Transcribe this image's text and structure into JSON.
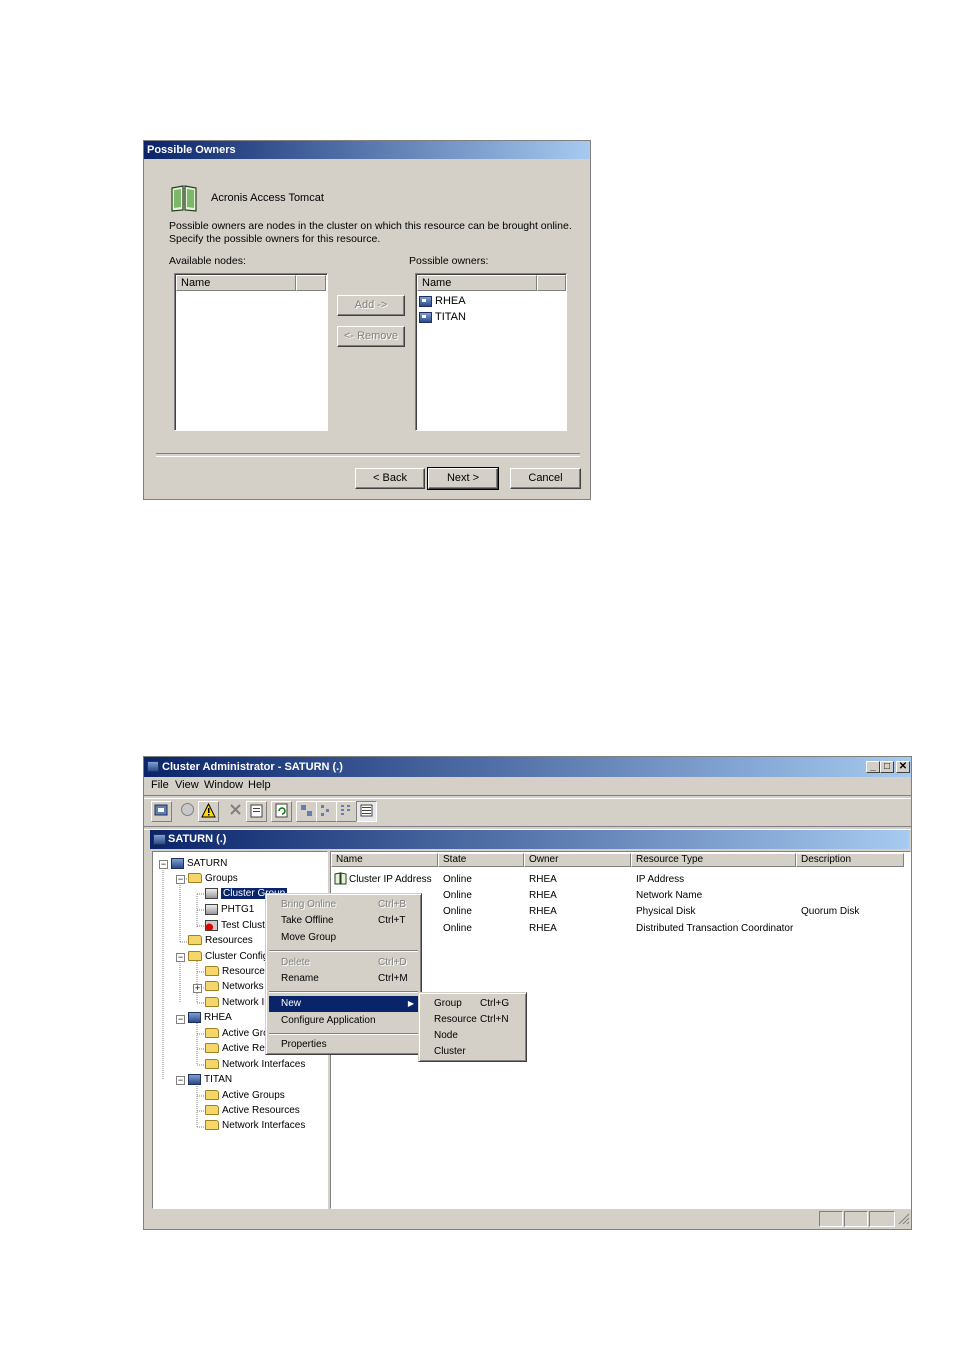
{
  "wizard": {
    "title": "Possible Owners",
    "resource_name": "Acronis Access Tomcat",
    "description_line1": "Possible owners are nodes in the cluster on which this resource can be brought online.",
    "description_line2": "Specify the possible owners for this resource.",
    "available_label": "Available nodes:",
    "owners_label": "Possible owners:",
    "column_name": "Name",
    "add_label": "Add ->",
    "remove_label": "<- Remove",
    "owners": [
      "RHEA",
      "TITAN"
    ],
    "back_label": "< Back",
    "next_label": "Next >",
    "cancel_label": "Cancel"
  },
  "cluster_admin": {
    "title": "Cluster Administrator - SATURN (.)",
    "menu": [
      "File",
      "View",
      "Window",
      "Help"
    ],
    "mdi_title": "SATURN (.)",
    "tree": {
      "root": "SATURN",
      "groups": "Groups",
      "cluster_group": "Cluster Group",
      "phtg1": "PHTG1",
      "test_cluster": "Test Cluste",
      "resources": "Resources",
      "cluster_config": "Cluster Configu",
      "resource_types": "Resource T",
      "networks": "Networks",
      "network_if": "Network Ir",
      "rhea": "RHEA",
      "rhea_active_groups": "Active Grou",
      "rhea_active_res": "Active Res",
      "rhea_network_if": "Network Interfaces",
      "titan": "TITAN",
      "titan_active_groups": "Active Groups",
      "titan_active_res": "Active Resources",
      "titan_network_if": "Network Interfaces"
    },
    "columns": [
      "Name",
      "State",
      "Owner",
      "Resource Type",
      "Description"
    ],
    "rows": [
      {
        "name": "Cluster IP Address",
        "state": "Online",
        "owner": "RHEA",
        "type": "IP Address",
        "desc": ""
      },
      {
        "name": "",
        "state": "Online",
        "owner": "RHEA",
        "type": "Network Name",
        "desc": ""
      },
      {
        "name": "",
        "state": "Online",
        "owner": "RHEA",
        "type": "Physical Disk",
        "desc": "Quorum Disk"
      },
      {
        "name": "",
        "state": "Online",
        "owner": "RHEA",
        "type": "Distributed Transaction Coordinator",
        "desc": ""
      }
    ],
    "context_menu": {
      "bring_online": "Bring Online",
      "bring_online_sc": "Ctrl+B",
      "take_offline": "Take Offline",
      "take_offline_sc": "Ctrl+T",
      "move_group": "Move Group",
      "delete": "Delete",
      "delete_sc": "Ctrl+D",
      "rename": "Rename",
      "rename_sc": "Ctrl+M",
      "new": "New",
      "configure_app": "Configure Application",
      "properties": "Properties"
    },
    "submenu": {
      "group": "Group",
      "group_sc": "Ctrl+G",
      "resource": "Resource",
      "resource_sc": "Ctrl+N",
      "node": "Node",
      "cluster": "Cluster"
    }
  }
}
